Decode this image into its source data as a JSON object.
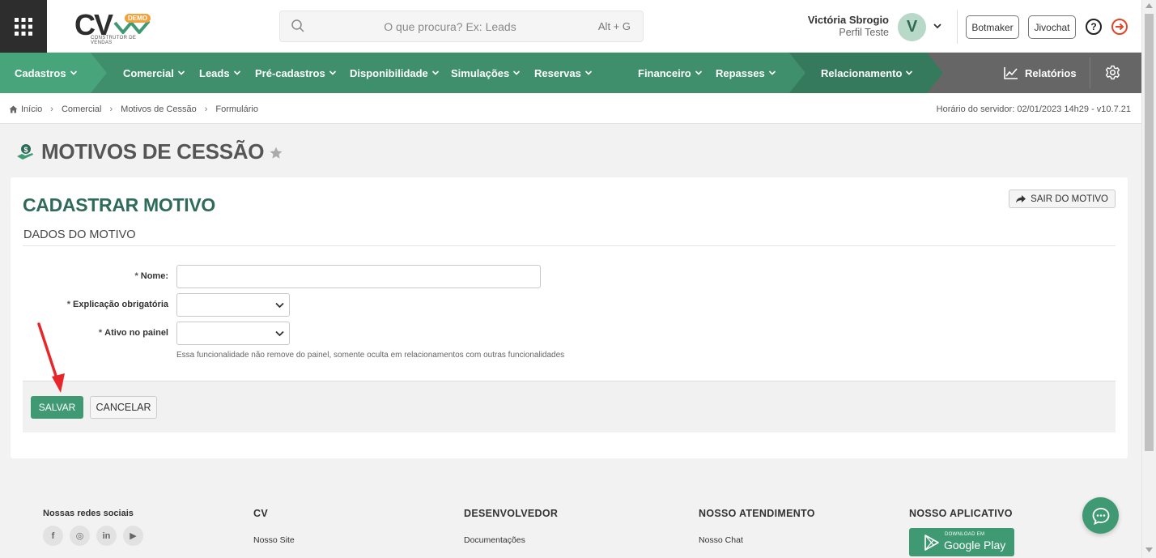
{
  "header": {
    "logo_text": "CV",
    "logo_badge": "DEMO",
    "logo_subtitle": "CONSTRUTOR DE VENDAS",
    "search_placeholder": "O que procura? Ex: Leads",
    "search_shortcut": "Alt + G",
    "user_name": "Victória Sbrogio",
    "user_profile": "Perfil Teste",
    "avatar_letter": "V",
    "btn_botmaker": "Botmaker",
    "btn_jivochat": "Jivochat",
    "help_symbol": "?"
  },
  "nav": {
    "items": [
      {
        "label": "Cadastros"
      },
      {
        "label": "Comercial"
      },
      {
        "label": "Leads"
      },
      {
        "label": "Pré-cadastros"
      },
      {
        "label": "Disponibilidade"
      },
      {
        "label": "Simulações"
      },
      {
        "label": "Reservas"
      },
      {
        "label": "Financeiro"
      },
      {
        "label": "Repasses"
      },
      {
        "label": "Relacionamento"
      }
    ],
    "reports_label": "Relatórios",
    "colors": {
      "green_light": "#48a57b",
      "green_mid": "#3f8f6c",
      "green_dark": "#357a5d",
      "gray": "#666666"
    }
  },
  "breadcrumb": {
    "items": [
      "Início",
      "Comercial",
      "Motivos de Cessão",
      "Formulário"
    ],
    "server_time": "Horário do servidor: 02/01/2023 14h29 - v10.7.21"
  },
  "page": {
    "title": "MOTIVOS DE CESSÃO"
  },
  "form": {
    "heading": "CADASTRAR MOTIVO",
    "exit_label": "SAIR DO MOTIVO",
    "section": "DADOS DO MOTIVO",
    "required_mark": "*",
    "fields": {
      "nome_label": "Nome:",
      "nome_value": "",
      "explicacao_label": "Explicação obrigatória",
      "explicacao_value": "",
      "ativo_label": "Ativo no painel",
      "ativo_value": "",
      "ativo_hint": "Essa funcionalidade não remove do painel, somente oculta em relacionamentos com outras funcionalidades"
    },
    "save_label": "SALVAR",
    "cancel_label": "CANCELAR"
  },
  "footer": {
    "social_title": "Nossas redes sociais",
    "social_icons": [
      "f",
      "◎",
      "in",
      "▶"
    ],
    "col_cv": "CV",
    "col_cv_link": "Nosso Site",
    "col_dev": "DESENVOLVEDOR",
    "col_dev_link": "Documentações",
    "col_att": "NOSSO ATENDIMENTO",
    "col_att_link": "Nosso Chat",
    "col_app": "NOSSO APLICATIVO",
    "gplay_small": "DOWNLOAD EM",
    "gplay_big": "Google Play"
  },
  "accent_color": "#3f9a74",
  "title_color": "#2e6b5a",
  "annotation_color": "#e8262a"
}
